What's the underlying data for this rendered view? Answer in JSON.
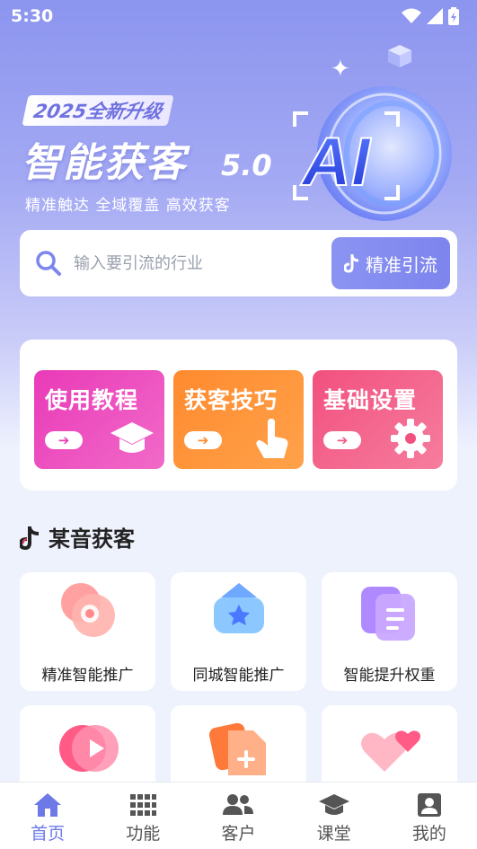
{
  "status": {
    "time": "5:30"
  },
  "hero": {
    "badge": "2025全新升级",
    "title": "智能获客",
    "version": "5.0",
    "subtitle": "精准触达 全域覆盖 高效获客",
    "logo_text": "AI"
  },
  "search": {
    "placeholder": "输入要引流的行业",
    "button_label": "精准引流"
  },
  "quick_tiles": [
    {
      "label": "使用教程",
      "arrow": "➔",
      "icon": "graduation-cap-icon",
      "color": "#e940b5"
    },
    {
      "label": "获客技巧",
      "arrow": "➔",
      "icon": "tap-hand-icon",
      "color": "#ff8a2e"
    },
    {
      "label": "基础设置",
      "arrow": "➔",
      "icon": "gear-icon",
      "color": "#f25d86"
    }
  ],
  "section": {
    "title": "某音获客"
  },
  "features": [
    {
      "label": "精准智能推广",
      "icon": "target-icon"
    },
    {
      "label": "同城智能推广",
      "icon": "location-icon"
    },
    {
      "label": "智能提升权重",
      "icon": "document-stack-icon"
    },
    {
      "label": "",
      "icon": "play-icon"
    },
    {
      "label": "",
      "icon": "add-file-icon"
    },
    {
      "label": "",
      "icon": "hearts-icon"
    }
  ],
  "tabs": [
    {
      "label": "首页",
      "icon": "home-icon",
      "active": true
    },
    {
      "label": "功能",
      "icon": "grid-icon",
      "active": false
    },
    {
      "label": "客户",
      "icon": "users-icon",
      "active": false
    },
    {
      "label": "课堂",
      "icon": "graduation-cap-icon",
      "active": false
    },
    {
      "label": "我的",
      "icon": "profile-icon",
      "active": false
    }
  ],
  "colors": {
    "accent": "#7d85ee",
    "tab_active": "#6e79e8"
  }
}
